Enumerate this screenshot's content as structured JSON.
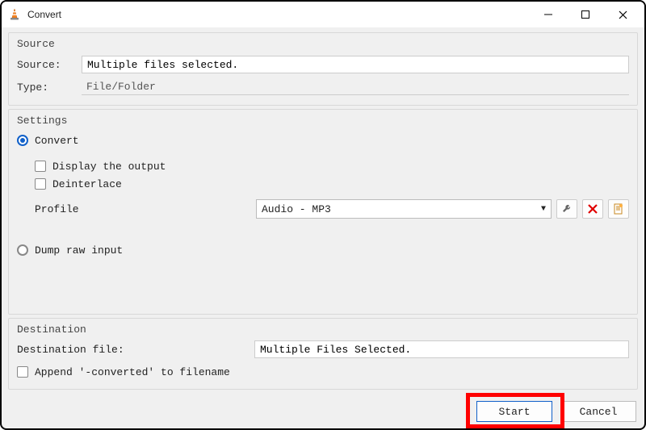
{
  "window": {
    "title": "Convert"
  },
  "source": {
    "group_title": "Source",
    "source_label": "Source:",
    "source_value": "Multiple files selected.",
    "type_label": "Type:",
    "type_value": "File/Folder"
  },
  "settings": {
    "group_title": "Settings",
    "convert_label": "Convert",
    "display_output_label": "Display the output",
    "deinterlace_label": "Deinterlace",
    "profile_label": "Profile",
    "profile_value": "Audio - MP3",
    "dump_raw_label": "Dump raw input"
  },
  "destination": {
    "group_title": "Destination",
    "dest_file_label": "Destination file:",
    "dest_file_value": "Multiple Files Selected.",
    "append_label": "Append '-converted' to filename"
  },
  "footer": {
    "start_label": "Start",
    "cancel_label": "Cancel"
  }
}
